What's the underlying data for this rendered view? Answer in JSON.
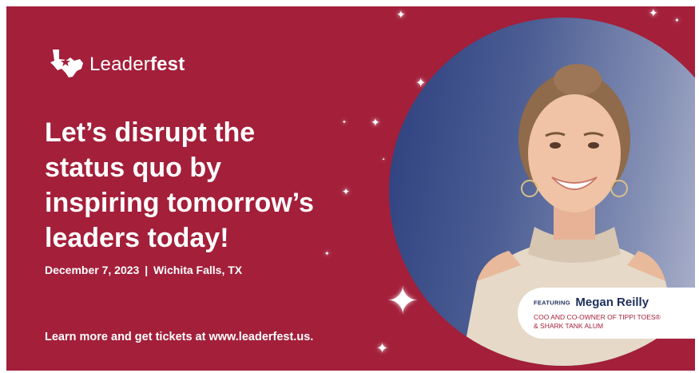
{
  "brand": {
    "name_light": "Leader",
    "name_bold": "fest",
    "logo_icon": "texas-state-icon"
  },
  "headline": {
    "line1": "Let’s disrupt the",
    "line2": "status quo by",
    "line3": "inspiring tomorrow’s",
    "line4": "leaders today!"
  },
  "event": {
    "date": "December 7, 2023",
    "separator": "|",
    "location": "Wichita Falls, TX"
  },
  "cta": {
    "text": "Learn more and get tickets at www.leaderfest.us."
  },
  "speaker": {
    "featuring_label": "FEATURING",
    "name": "Megan Reilly",
    "role_line1": "COO AND CO-OWNER OF TIPPI TOES®",
    "role_line2": "& SHARK TANK ALUM"
  },
  "colors": {
    "background": "#a31f3a",
    "text": "#ffffff",
    "navy": "#1e2f5c"
  }
}
